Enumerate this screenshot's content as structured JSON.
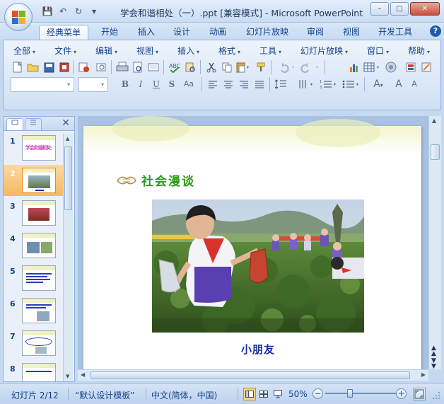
{
  "window": {
    "title": "学会和谐相处（一）.ppt [兼容模式] - Microsoft PowerPoint",
    "minimize_glyph": "–",
    "maximize_glyph": "□",
    "close_glyph": "✕"
  },
  "quick_access": {
    "icons": [
      "save-icon",
      "undo-icon",
      "redo-icon",
      "customize-icon"
    ],
    "glyphs": [
      "💾",
      "↶",
      "↻",
      "▾"
    ]
  },
  "ribbon_tabs": [
    {
      "label": "经典菜单",
      "active": true
    },
    {
      "label": "开始"
    },
    {
      "label": "插入"
    },
    {
      "label": "设计"
    },
    {
      "label": "动画"
    },
    {
      "label": "幻灯片放映"
    },
    {
      "label": "审阅"
    },
    {
      "label": "视图"
    },
    {
      "label": "开发工具"
    }
  ],
  "help_glyph": "?",
  "classic_menu": [
    {
      "label": "全部"
    },
    {
      "label": "文件"
    },
    {
      "label": "编辑"
    },
    {
      "label": "视图"
    },
    {
      "label": "插入"
    },
    {
      "label": "格式"
    },
    {
      "label": "工具"
    },
    {
      "label": "幻灯片放映"
    },
    {
      "label": "窗口"
    },
    {
      "label": "帮助"
    }
  ],
  "menu_arrow": "▾",
  "toolbar_row1_icons": [
    "new-icon",
    "open-icon",
    "save-icon",
    "permission-icon",
    "email-icon",
    "print-preview-icon",
    "print-icon",
    "preview-icon",
    "page-setup-icon",
    "spelling-icon",
    "research-icon",
    "cut-icon",
    "copy-icon",
    "paste-icon",
    "format-painter-icon",
    "undo-icon",
    "redo-icon",
    "chart-icon",
    "table-icon",
    "insert-picture-icon",
    "color-icon",
    "zoom-icon"
  ],
  "format_buttons": [
    {
      "name": "bold-button",
      "label": "B"
    },
    {
      "name": "italic-button",
      "label": "I"
    },
    {
      "name": "underline-button",
      "label": "U"
    },
    {
      "name": "shadow-button",
      "label": "S"
    },
    {
      "name": "change-case-button",
      "label": "Aa"
    }
  ],
  "font_buttons": [
    {
      "name": "font-color-button",
      "label": "A"
    },
    {
      "name": "grow-font-button",
      "label": "A"
    },
    {
      "name": "shrink-font-button",
      "label": "A"
    }
  ],
  "slide_panel": {
    "close_glyph": "✕",
    "thumbnails": [
      {
        "num": "1",
        "title": "学会和谐相处"
      },
      {
        "num": "2",
        "selected": true
      },
      {
        "num": "3"
      },
      {
        "num": "4"
      },
      {
        "num": "5"
      },
      {
        "num": "6"
      },
      {
        "num": "7"
      },
      {
        "num": "8"
      }
    ]
  },
  "slide": {
    "heading": "社会漫谈",
    "caption": "小朋友"
  },
  "status": {
    "slide_info": "幻灯片 2/12",
    "template": "“默认设计模板”",
    "language": "中文(简体，中国)",
    "zoom": "50%",
    "zoom_minus": "−",
    "zoom_plus": "+",
    "zoom_level": 0.35
  },
  "colors": {
    "heading": "#2f9a1b",
    "caption": "#1a2ea8",
    "selected_thumb": "#f5b860"
  }
}
